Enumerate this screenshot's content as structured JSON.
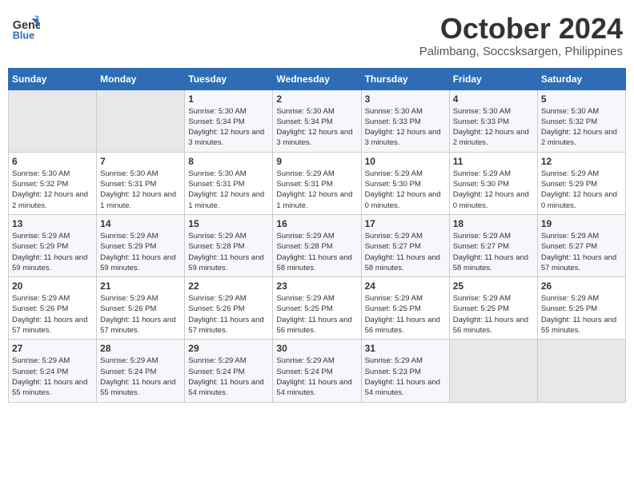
{
  "logo": {
    "line1": "General",
    "line2": "Blue"
  },
  "title": "October 2024",
  "location": "Palimbang, Soccsksargen, Philippines",
  "weekdays": [
    "Sunday",
    "Monday",
    "Tuesday",
    "Wednesday",
    "Thursday",
    "Friday",
    "Saturday"
  ],
  "weeks": [
    [
      {
        "day": "",
        "info": ""
      },
      {
        "day": "",
        "info": ""
      },
      {
        "day": "1",
        "info": "Sunrise: 5:30 AM\nSunset: 5:34 PM\nDaylight: 12 hours and 3 minutes."
      },
      {
        "day": "2",
        "info": "Sunrise: 5:30 AM\nSunset: 5:34 PM\nDaylight: 12 hours and 3 minutes."
      },
      {
        "day": "3",
        "info": "Sunrise: 5:30 AM\nSunset: 5:33 PM\nDaylight: 12 hours and 3 minutes."
      },
      {
        "day": "4",
        "info": "Sunrise: 5:30 AM\nSunset: 5:33 PM\nDaylight: 12 hours and 2 minutes."
      },
      {
        "day": "5",
        "info": "Sunrise: 5:30 AM\nSunset: 5:32 PM\nDaylight: 12 hours and 2 minutes."
      }
    ],
    [
      {
        "day": "6",
        "info": "Sunrise: 5:30 AM\nSunset: 5:32 PM\nDaylight: 12 hours and 2 minutes."
      },
      {
        "day": "7",
        "info": "Sunrise: 5:30 AM\nSunset: 5:31 PM\nDaylight: 12 hours and 1 minute."
      },
      {
        "day": "8",
        "info": "Sunrise: 5:30 AM\nSunset: 5:31 PM\nDaylight: 12 hours and 1 minute."
      },
      {
        "day": "9",
        "info": "Sunrise: 5:29 AM\nSunset: 5:31 PM\nDaylight: 12 hours and 1 minute."
      },
      {
        "day": "10",
        "info": "Sunrise: 5:29 AM\nSunset: 5:30 PM\nDaylight: 12 hours and 0 minutes."
      },
      {
        "day": "11",
        "info": "Sunrise: 5:29 AM\nSunset: 5:30 PM\nDaylight: 12 hours and 0 minutes."
      },
      {
        "day": "12",
        "info": "Sunrise: 5:29 AM\nSunset: 5:29 PM\nDaylight: 12 hours and 0 minutes."
      }
    ],
    [
      {
        "day": "13",
        "info": "Sunrise: 5:29 AM\nSunset: 5:29 PM\nDaylight: 11 hours and 59 minutes."
      },
      {
        "day": "14",
        "info": "Sunrise: 5:29 AM\nSunset: 5:29 PM\nDaylight: 11 hours and 59 minutes."
      },
      {
        "day": "15",
        "info": "Sunrise: 5:29 AM\nSunset: 5:28 PM\nDaylight: 11 hours and 59 minutes."
      },
      {
        "day": "16",
        "info": "Sunrise: 5:29 AM\nSunset: 5:28 PM\nDaylight: 11 hours and 58 minutes."
      },
      {
        "day": "17",
        "info": "Sunrise: 5:29 AM\nSunset: 5:27 PM\nDaylight: 11 hours and 58 minutes."
      },
      {
        "day": "18",
        "info": "Sunrise: 5:29 AM\nSunset: 5:27 PM\nDaylight: 11 hours and 58 minutes."
      },
      {
        "day": "19",
        "info": "Sunrise: 5:29 AM\nSunset: 5:27 PM\nDaylight: 11 hours and 57 minutes."
      }
    ],
    [
      {
        "day": "20",
        "info": "Sunrise: 5:29 AM\nSunset: 5:26 PM\nDaylight: 11 hours and 57 minutes."
      },
      {
        "day": "21",
        "info": "Sunrise: 5:29 AM\nSunset: 5:26 PM\nDaylight: 11 hours and 57 minutes."
      },
      {
        "day": "22",
        "info": "Sunrise: 5:29 AM\nSunset: 5:26 PM\nDaylight: 11 hours and 57 minutes."
      },
      {
        "day": "23",
        "info": "Sunrise: 5:29 AM\nSunset: 5:25 PM\nDaylight: 11 hours and 56 minutes."
      },
      {
        "day": "24",
        "info": "Sunrise: 5:29 AM\nSunset: 5:25 PM\nDaylight: 11 hours and 56 minutes."
      },
      {
        "day": "25",
        "info": "Sunrise: 5:29 AM\nSunset: 5:25 PM\nDaylight: 11 hours and 56 minutes."
      },
      {
        "day": "26",
        "info": "Sunrise: 5:29 AM\nSunset: 5:25 PM\nDaylight: 11 hours and 55 minutes."
      }
    ],
    [
      {
        "day": "27",
        "info": "Sunrise: 5:29 AM\nSunset: 5:24 PM\nDaylight: 11 hours and 55 minutes."
      },
      {
        "day": "28",
        "info": "Sunrise: 5:29 AM\nSunset: 5:24 PM\nDaylight: 11 hours and 55 minutes."
      },
      {
        "day": "29",
        "info": "Sunrise: 5:29 AM\nSunset: 5:24 PM\nDaylight: 11 hours and 54 minutes."
      },
      {
        "day": "30",
        "info": "Sunrise: 5:29 AM\nSunset: 5:24 PM\nDaylight: 11 hours and 54 minutes."
      },
      {
        "day": "31",
        "info": "Sunrise: 5:29 AM\nSunset: 5:23 PM\nDaylight: 11 hours and 54 minutes."
      },
      {
        "day": "",
        "info": ""
      },
      {
        "day": "",
        "info": ""
      }
    ]
  ]
}
